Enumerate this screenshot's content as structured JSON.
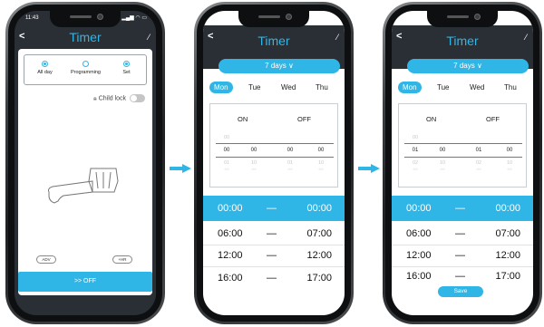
{
  "status": {
    "time": "11:43"
  },
  "phone1": {
    "title": "Timer",
    "modes": [
      "All day",
      "Programming",
      "Set"
    ],
    "child_lock_label": "Child lock",
    "adv_label": "ADV",
    "hr_label": "+HR",
    "off_button": ">> OFF"
  },
  "phone2": {
    "title": "Timer",
    "days_button": "7 days ∨",
    "weekdays": [
      "Mon",
      "Tue",
      "Wed",
      "Thu"
    ],
    "on_label": "ON",
    "off_label": "OFF",
    "picker_above": [
      "00"
    ],
    "picker_selected": [
      "00",
      "00",
      "00",
      "00"
    ],
    "picker_below": [
      "01",
      "10",
      "01",
      "10"
    ],
    "picker_below2": [
      "0:0",
      "0:0",
      "0:0",
      "0:0"
    ],
    "rows": [
      {
        "on": "00:00",
        "dash": "—",
        "off": "00:00"
      },
      {
        "on": "06:00",
        "dash": "—",
        "off": "07:00"
      },
      {
        "on": "12:00",
        "dash": "—",
        "off": "12:00"
      },
      {
        "on": "16:00",
        "dash": "—",
        "off": "17:00"
      }
    ]
  },
  "phone3": {
    "title": "Timer",
    "days_button": "7 days ∨",
    "weekdays": [
      "Mon",
      "Tue",
      "Wed",
      "Thu"
    ],
    "on_label": "ON",
    "off_label": "OFF",
    "picker_above": [
      "00"
    ],
    "picker_selected": [
      "01",
      "00",
      "01",
      "00"
    ],
    "picker_below": [
      "02",
      "10",
      "02",
      "10"
    ],
    "picker_below2": [
      "0:0",
      "0:0",
      "0:0",
      "0:0"
    ],
    "rows": [
      {
        "on": "00:00",
        "dash": "—",
        "off": "00:00"
      },
      {
        "on": "06:00",
        "dash": "—",
        "off": "07:00"
      },
      {
        "on": "12:00",
        "dash": "—",
        "off": "12:00"
      },
      {
        "on": "16:00",
        "dash": "—",
        "off": "17:00"
      }
    ],
    "save_button": "Save"
  },
  "colors": {
    "accent": "#2fb6e6",
    "dark_header": "#2a2f36"
  }
}
